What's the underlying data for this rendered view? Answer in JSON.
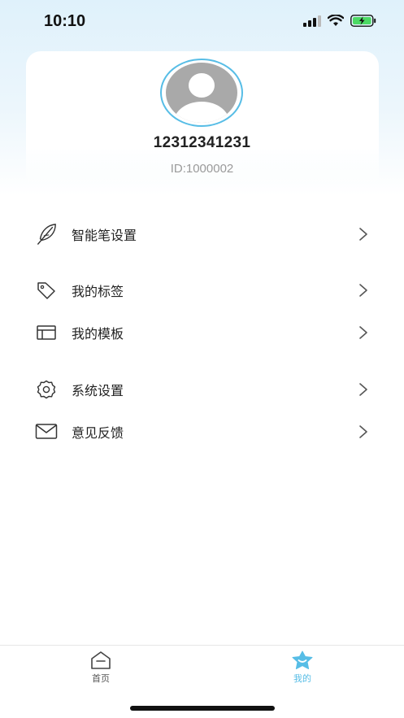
{
  "status_bar": {
    "time": "10:10"
  },
  "profile": {
    "username": "12312341231",
    "user_id": "ID:1000002"
  },
  "menu": {
    "pen_settings": "智能笔设置",
    "my_tags": "我的标签",
    "my_templates": "我的模板",
    "system_settings": "系统设置",
    "feedback": "意见反馈"
  },
  "tabbar": {
    "home": "首页",
    "mine": "我的"
  },
  "colors": {
    "accent": "#57bde6",
    "text": "#222222",
    "muted": "#9a9a9a",
    "battery": "#4cd964"
  }
}
